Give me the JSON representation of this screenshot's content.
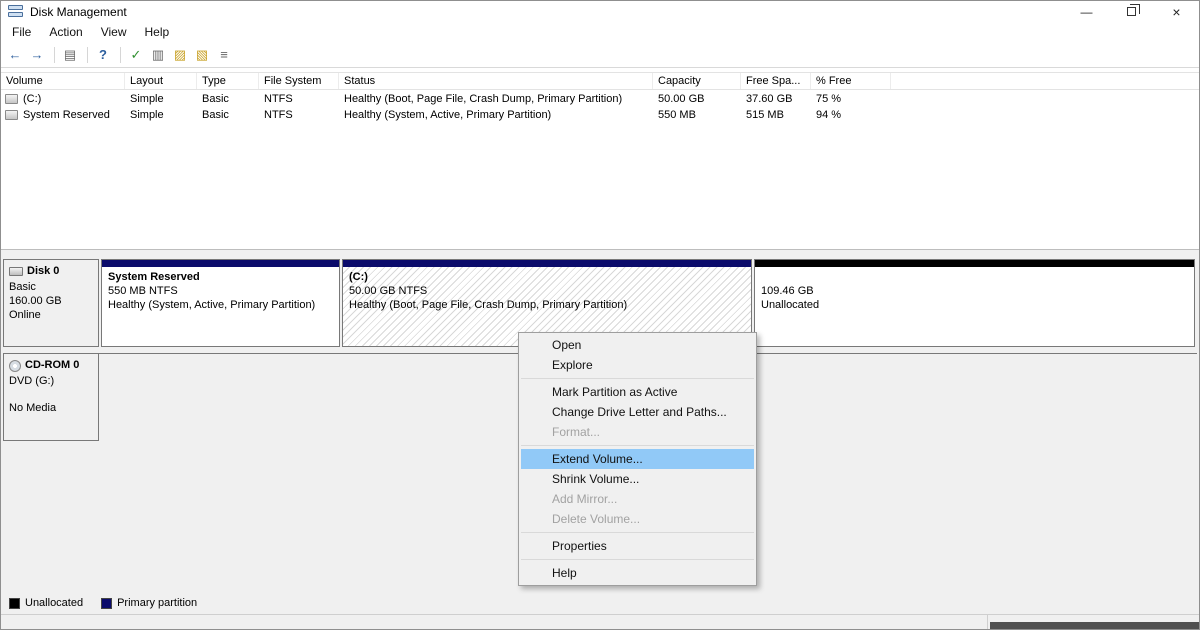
{
  "titlebar": {
    "title": "Disk Management",
    "minimize_glyph": "—",
    "close_glyph": "×"
  },
  "menubar": {
    "items": [
      "File",
      "Action",
      "View",
      "Help"
    ]
  },
  "toolbar": {
    "icons": [
      {
        "name": "back-icon",
        "glyph": "←"
      },
      {
        "name": "forward-icon",
        "glyph": "→"
      },
      {
        "name": "show-console-tree-icon",
        "glyph": "▤"
      },
      {
        "name": "help-icon",
        "glyph": "?"
      },
      {
        "name": "check-disk-icon",
        "glyph": "✓"
      },
      {
        "name": "views-icon",
        "glyph": "▥"
      },
      {
        "name": "folder-icon",
        "glyph": "▨"
      },
      {
        "name": "actions-icon",
        "glyph": "▧"
      },
      {
        "name": "details-view-icon",
        "glyph": "≡"
      }
    ]
  },
  "volume_table": {
    "columns": [
      "Volume",
      "Layout",
      "Type",
      "File System",
      "Status",
      "Capacity",
      "Free Spa...",
      "% Free"
    ],
    "rows": [
      {
        "volume": "(C:)",
        "layout": "Simple",
        "type": "Basic",
        "file_system": "NTFS",
        "status": "Healthy (Boot, Page File, Crash Dump, Primary Partition)",
        "capacity": "50.00 GB",
        "free_space": "37.60 GB",
        "pct_free": "75 %"
      },
      {
        "volume": "System Reserved",
        "layout": "Simple",
        "type": "Basic",
        "file_system": "NTFS",
        "status": "Healthy (System, Active, Primary Partition)",
        "capacity": "550 MB",
        "free_space": "515 MB",
        "pct_free": "94 %"
      }
    ]
  },
  "disk0": {
    "name": "Disk 0",
    "type": "Basic",
    "size": "160.00 GB",
    "status": "Online",
    "partitions": [
      {
        "title": "System Reserved",
        "size_line": "550 MB NTFS",
        "status_line": "Healthy (System, Active, Primary Partition)"
      },
      {
        "title": "(C:)",
        "size_line": "50.00 GB NTFS",
        "status_line": "Healthy (Boot, Page File, Crash Dump, Primary Partition)"
      },
      {
        "title": "",
        "size_line": "109.46 GB",
        "status_line": "Unallocated"
      }
    ]
  },
  "cdrom0": {
    "name": "CD-ROM 0",
    "drive": "DVD (G:)",
    "status": "No Media"
  },
  "context_menu": {
    "items": [
      {
        "label": "Open"
      },
      {
        "label": "Explore"
      },
      {
        "label": "Mark Partition as Active"
      },
      {
        "label": "Change Drive Letter and Paths..."
      },
      {
        "label": "Format..."
      },
      {
        "label": "Extend Volume..."
      },
      {
        "label": "Shrink Volume..."
      },
      {
        "label": "Add Mirror..."
      },
      {
        "label": "Delete Volume..."
      },
      {
        "label": "Properties"
      },
      {
        "label": "Help"
      }
    ]
  },
  "legend": {
    "unallocated": "Unallocated",
    "primary": "Primary partition"
  },
  "colors": {
    "primary_partition": "#0b0b6b",
    "unallocated": "#000000",
    "menu_highlight": "#91c9f7",
    "window_bg": "#f0f0f0"
  }
}
